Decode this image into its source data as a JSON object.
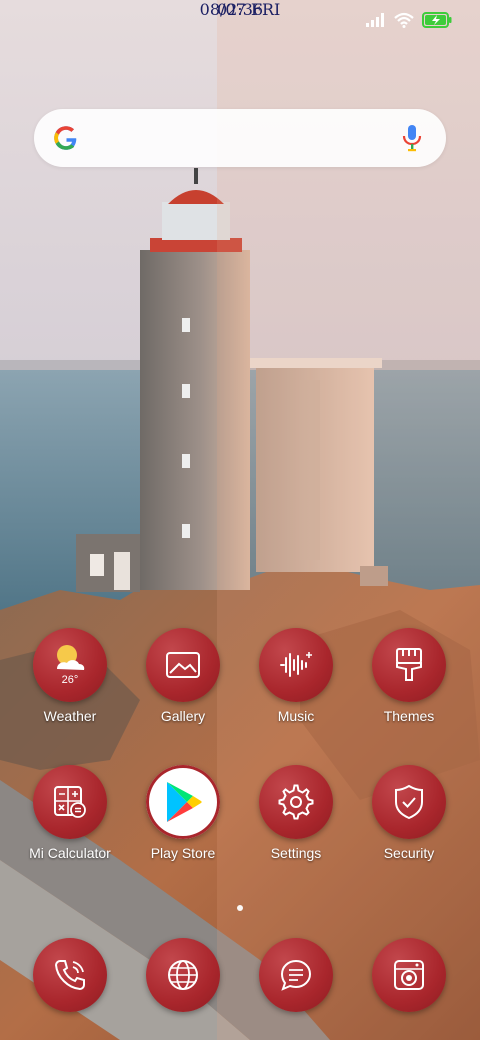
{
  "statusbar": {
    "icons": [
      "signal-icon",
      "wifi-icon",
      "battery-charging-icon"
    ]
  },
  "search": {
    "icons": [
      "google-logo",
      "mic-icon"
    ]
  },
  "clock": {
    "time": "02:36",
    "date": "08/07 FRI"
  },
  "weather": {
    "temperature": "26°"
  },
  "apps": [
    {
      "label": "Weather",
      "icon": "weather-icon"
    },
    {
      "label": "Gallery",
      "icon": "gallery-icon"
    },
    {
      "label": "Music",
      "icon": "music-icon"
    },
    {
      "label": "Themes",
      "icon": "brush-icon"
    },
    {
      "label": "Mi Calculator",
      "icon": "calculator-icon"
    },
    {
      "label": "Play Store",
      "icon": "play-store-icon"
    },
    {
      "label": "Settings",
      "icon": "gear-icon"
    },
    {
      "label": "Security",
      "icon": "shield-check-icon"
    }
  ],
  "dock": [
    {
      "icon": "phone-icon"
    },
    {
      "icon": "globe-icon"
    },
    {
      "icon": "chat-icon"
    },
    {
      "icon": "camera-icon"
    }
  ],
  "pager": {
    "pages": 1,
    "current": 1
  },
  "colors": {
    "icon_red": "#a9262c",
    "clock_text": "#1b1f63"
  }
}
